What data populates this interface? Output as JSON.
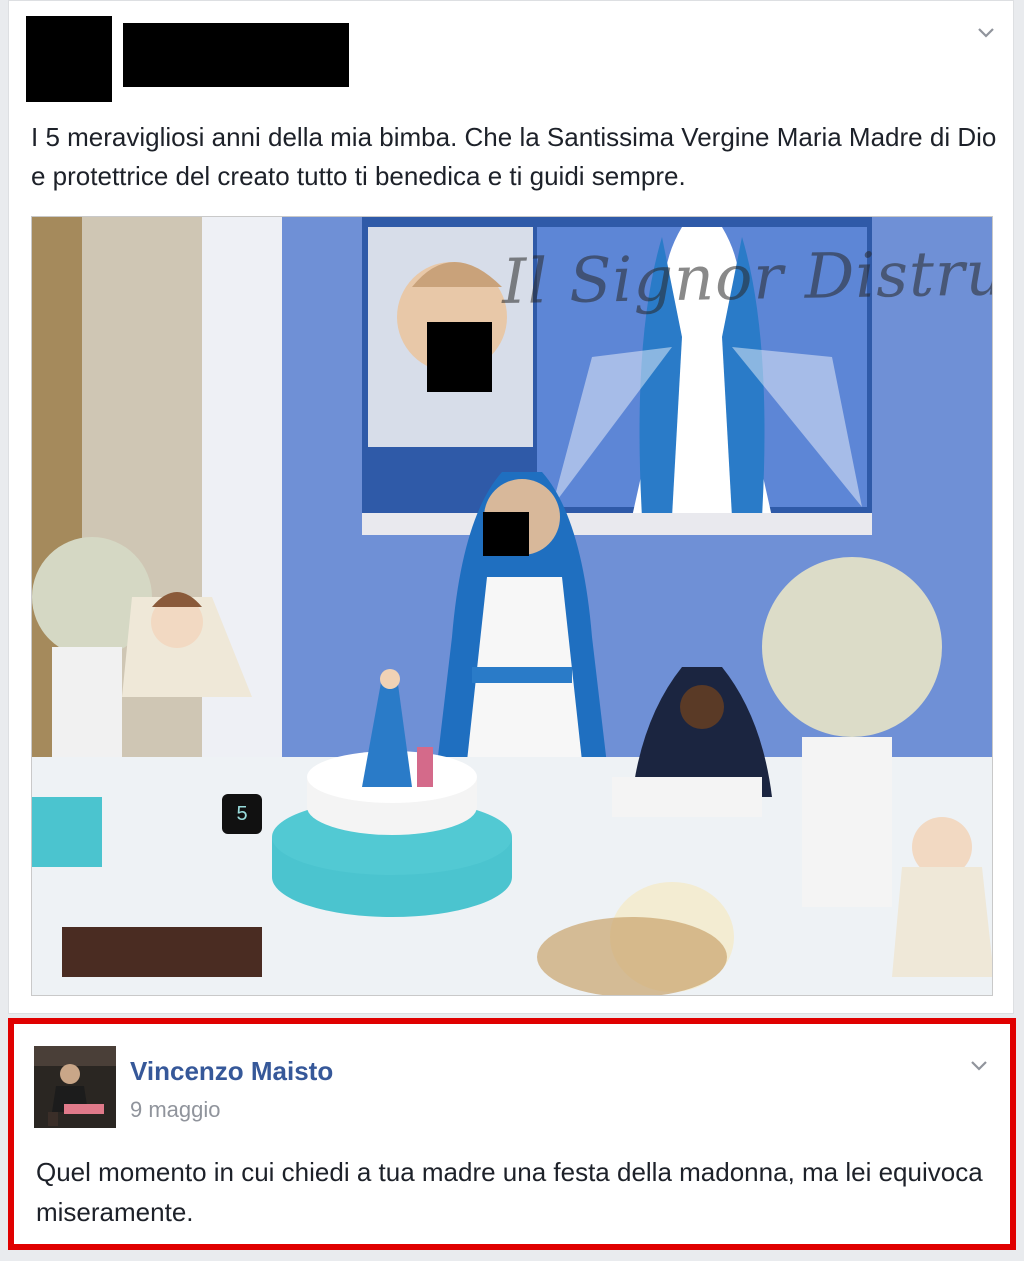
{
  "post": {
    "text": "I 5 meravigliosi anni della mia bimba. Che la Santissima Vergine Maria Madre di Dio e protettrice del creato tutto ti benedica e ti guidi sempre.",
    "menu_icon": "chevron-down-icon",
    "photo": {
      "watermark": "Il Signor Distruggere",
      "cake_number": "5"
    }
  },
  "comment": {
    "author": "Vincenzo Maisto",
    "date": "9 maggio",
    "text": "Quel momento in cui chiedi a tua madre una festa della madonna, ma lei equivoca miseramente.",
    "menu_icon": "chevron-down-icon",
    "highlight_color": "#e00000"
  },
  "colors": {
    "name_link": "#365899",
    "muted": "#90949c",
    "text": "#1d2129",
    "wall_blue": "#6f90d6"
  }
}
